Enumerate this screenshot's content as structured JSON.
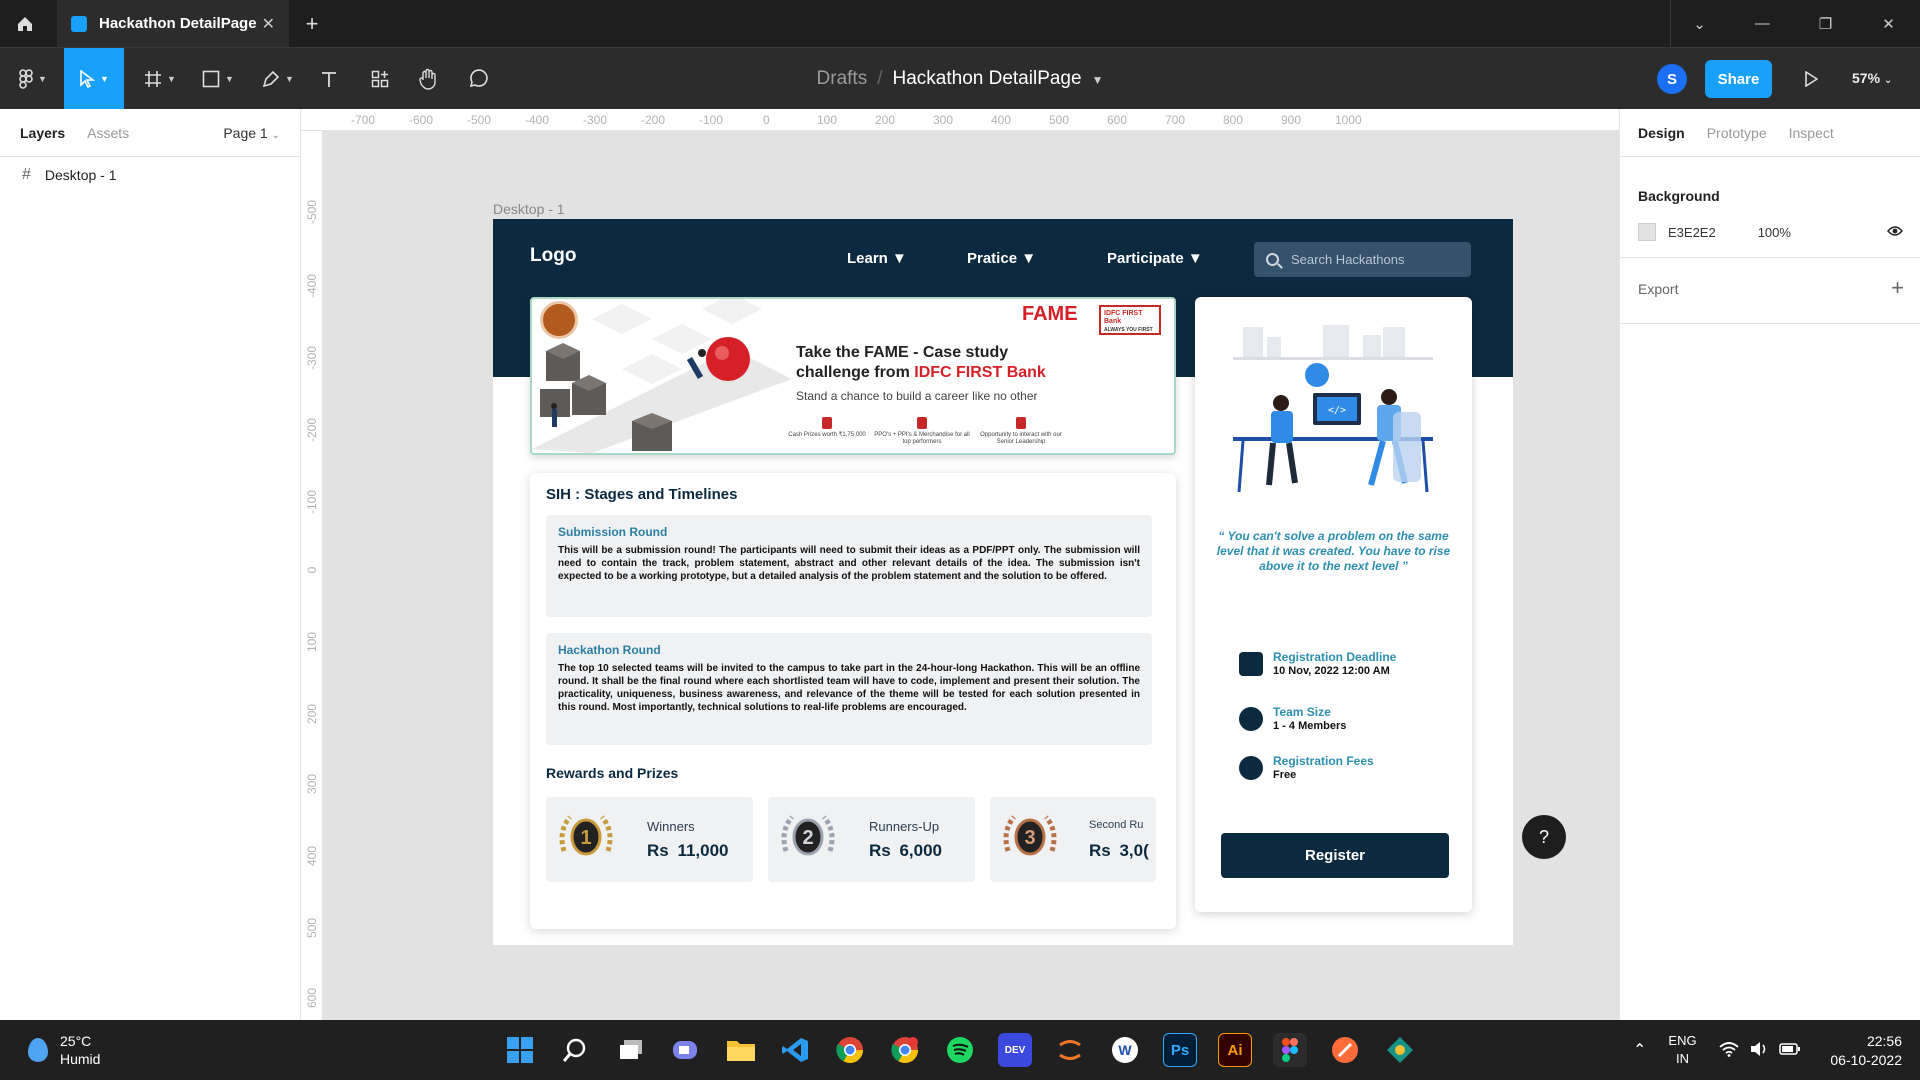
{
  "titlebar": {
    "tab_title": "Hackathon DetailPage",
    "close": "✕",
    "new_tab": "+"
  },
  "toolbar": {
    "breadcrumb_parent": "Drafts",
    "breadcrumb_sep": "/",
    "file_name": "Hackathon DetailPage",
    "user_initial": "S",
    "share_label": "Share",
    "zoom": "57%"
  },
  "left_panel": {
    "tab_layers": "Layers",
    "tab_assets": "Assets",
    "page_label": "Page 1",
    "layers": [
      {
        "name": "Desktop - 1"
      }
    ]
  },
  "rulers": {
    "top": [
      "-700",
      "-600",
      "-500",
      "-400",
      "-300",
      "-200",
      "-100",
      "0",
      "100",
      "200",
      "300",
      "400",
      "500",
      "600",
      "700",
      "800",
      "900",
      "1000"
    ],
    "left": [
      "-500",
      "-400",
      "-300",
      "-200",
      "-100",
      "0",
      "100",
      "200",
      "300",
      "400",
      "500",
      "600"
    ]
  },
  "canvas": {
    "frame_label": "Desktop - 1",
    "nav": {
      "logo": "Logo",
      "links": [
        "Learn ▼",
        "Pratice ▼",
        "Participate ▼"
      ],
      "search_placeholder": "Search Hackathons"
    },
    "banner": {
      "fame": "FAME",
      "idfc": "IDFC FIRST Bank",
      "idfc_tag": "ALWAYS YOU FIRST",
      "title_line1": "Take the FAME - Case study",
      "title_line2_prefix": "challenge from ",
      "title_line2_brand": "IDFC FIRST Bank",
      "subtitle": "Stand a chance to build a career like no other",
      "features": [
        "Cash Prizes worth ₹1,75,000",
        "PPO's + PPI's & Merchandise for all top performers",
        "Opportunity to interact with our Senior Leadership"
      ]
    },
    "stages": {
      "title": "SIH : Stages and Timelines",
      "rounds": [
        {
          "title": "Submission Round",
          "body": "This will be a submission round! The participants will need to submit their ideas as a PDF/PPT only. The submission will need to contain the track, problem statement, abstract and other relevant details of the idea. The submission isn't expected to be a working prototype, but a detailed analysis of the problem statement and the solution to be offered."
        },
        {
          "title": "Hackathon Round",
          "body": "The top 10 selected teams will be invited to the campus to take part in the 24-hour-long Hackathon. This will be an offline round. It shall be the final round where each shortlisted team will have to code, implement and present their solution. The practicality, uniqueness, business awareness, and relevance of the theme will be tested for each solution presented in this round. Most importantly, technical solutions to real-life problems are encouraged."
        }
      ],
      "rewards_title": "Rewards and Prizes",
      "prizes": [
        {
          "label": "Winners",
          "amount": "Rs  11,000",
          "rank": "1",
          "color": "#c99a3c"
        },
        {
          "label": "Runners-Up",
          "amount": "Rs  6,000",
          "rank": "2",
          "color": "#9aa3ad"
        },
        {
          "label": "Second Ru",
          "amount": "Rs  3,0(",
          "rank": "3",
          "color": "#b8724a"
        }
      ]
    },
    "side": {
      "quote": "“ You can't solve a problem on the same level that it was created. You have to rise above it to the next level ”",
      "info": [
        {
          "label": "Registration Deadline",
          "value": "10 Nov, 2022  12:00 AM",
          "icon": "calendar-icon"
        },
        {
          "label": "Team Size",
          "value": "1 - 4 Members",
          "icon": "team-icon"
        },
        {
          "label": "Registration Fees",
          "value": "Free",
          "icon": "rupee-icon"
        }
      ],
      "register_label": "Register"
    },
    "help": "?"
  },
  "right_panel": {
    "tabs": [
      "Design",
      "Prototype",
      "Inspect"
    ],
    "background_title": "Background",
    "bg_hex": "E3E2E2",
    "bg_opacity": "100%",
    "export_label": "Export"
  },
  "taskbar": {
    "temp": "25°C",
    "condition": "Humid",
    "lang1": "ENG",
    "lang2": "IN",
    "time": "22:56",
    "date": "06-10-2022"
  }
}
